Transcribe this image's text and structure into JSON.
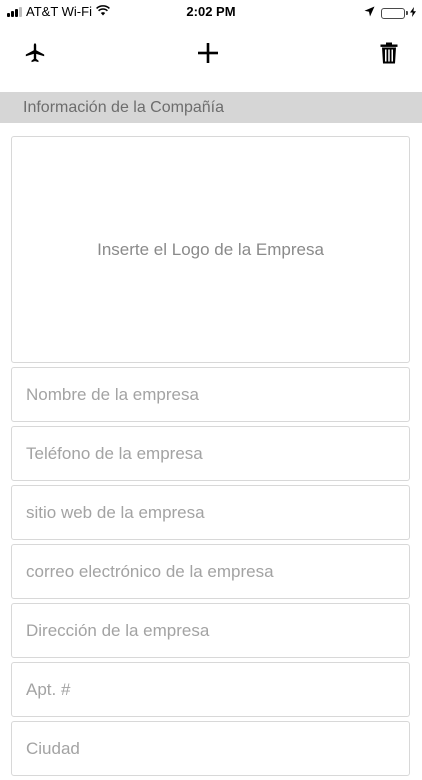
{
  "status_bar": {
    "carrier": "AT&T Wi-Fi",
    "time": "2:02 PM",
    "battery_color": "#4cd964"
  },
  "toolbar": {
    "left_icon": "airplane-icon",
    "center_icon": "plus-icon",
    "right_icon": "trash-icon"
  },
  "section": {
    "title": "Información de la Compañía"
  },
  "logo": {
    "label": "Inserte el Logo de la Empresa"
  },
  "fields": {
    "name": {
      "placeholder": "Nombre de la empresa",
      "value": ""
    },
    "phone": {
      "placeholder": "Teléfono de la empresa",
      "value": ""
    },
    "website": {
      "placeholder": "sitio web de la empresa",
      "value": ""
    },
    "email": {
      "placeholder": "correo electrónico de la empresa",
      "value": ""
    },
    "address": {
      "placeholder": "Dirección de la empresa",
      "value": ""
    },
    "apt": {
      "placeholder": "Apt. #",
      "value": ""
    },
    "city": {
      "placeholder": "Ciudad",
      "value": ""
    }
  }
}
